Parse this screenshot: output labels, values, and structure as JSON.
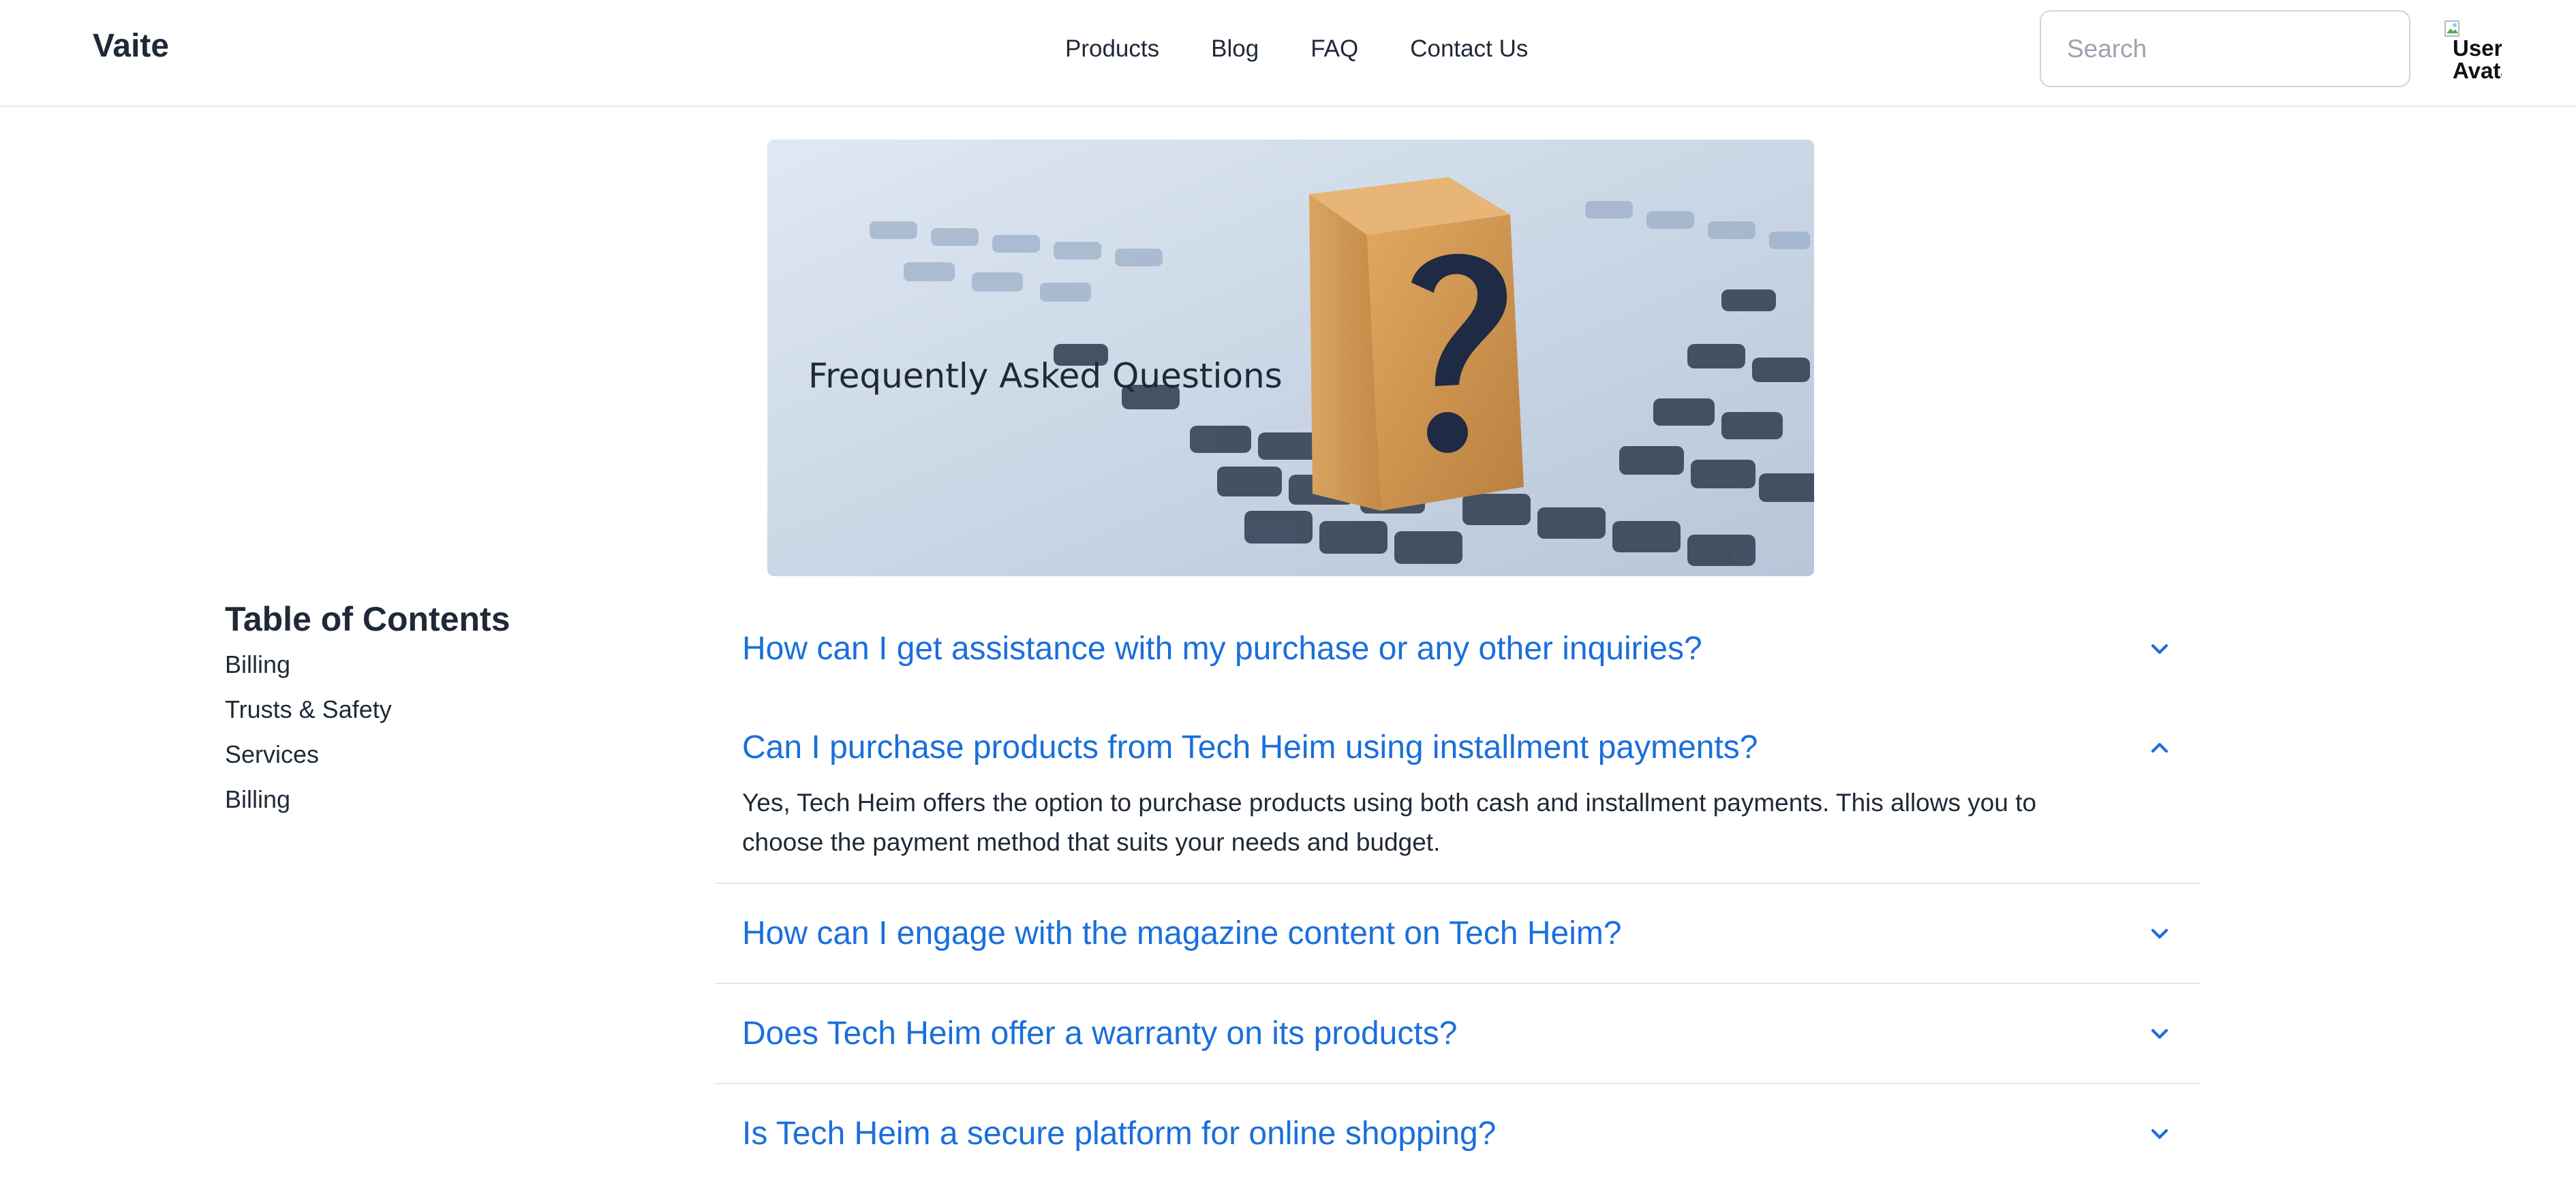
{
  "header": {
    "brand": "Vaite",
    "nav": [
      "Products",
      "Blog",
      "FAQ",
      "Contact Us"
    ],
    "search_placeholder": "Search",
    "avatar_alt": "User Avatar"
  },
  "hero": {
    "caption": "Frequently Asked Questions"
  },
  "toc": {
    "title": "Table of Contents",
    "items": [
      "Billing",
      "Trusts & Safety",
      "Services",
      "Billing"
    ]
  },
  "faq": [
    {
      "question": "How can I get assistance with my purchase or any other inquiries?",
      "expanded": false
    },
    {
      "question": "Can I purchase products from Tech Heim using installment payments?",
      "expanded": true,
      "answer": "Yes, Tech Heim offers the option to purchase products using both cash and installment payments. This allows you to choose the payment method that suits your needs and budget."
    },
    {
      "question": "How can I engage with the magazine content on Tech Heim?",
      "expanded": false
    },
    {
      "question": "Does Tech Heim offer a warranty on its products?",
      "expanded": false
    },
    {
      "question": "Is Tech Heim a secure platform for online shopping?",
      "expanded": false
    }
  ],
  "colors": {
    "accent": "#1a6fdb",
    "text": "#1f2937",
    "divider": "#e5e7eb"
  }
}
